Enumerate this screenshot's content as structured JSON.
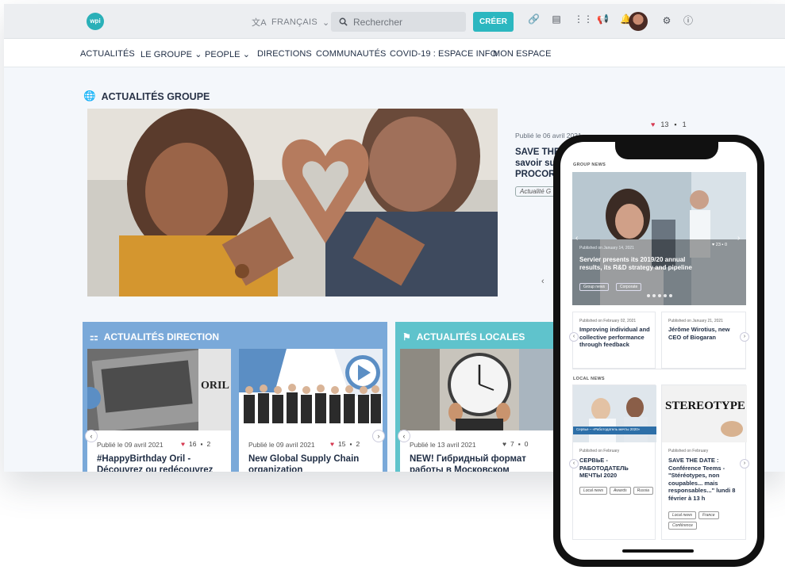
{
  "topbar": {
    "logo": "wpi",
    "language": "FRANÇAIS",
    "search_placeholder": "Rechercher",
    "create_label": "CRÉER"
  },
  "nav": {
    "items": [
      {
        "label": "ACTUALITÉS",
        "chev": ""
      },
      {
        "label": "LE GROUPE",
        "chev": "⌄"
      },
      {
        "label": "PEOPLE",
        "chev": "⌄"
      },
      {
        "label": "DIRECTIONS",
        "chev": ""
      },
      {
        "label": "COMMUNAUTÉS",
        "chev": ""
      },
      {
        "label": "COVID-19 : ESPACE INFO",
        "chev": ""
      },
      {
        "label": "MON ESPACE",
        "chev": ""
      }
    ]
  },
  "group_news": {
    "title": "ACTUALITÉS GROUPE",
    "published": "Publié le 06 avril 2021",
    "headline": "SAVE THE savoir su PROCOR",
    "tag": "Actualité G",
    "likes": "13",
    "comments": "1"
  },
  "direction": {
    "title": "ACTUALITÉS DIRECTION",
    "cards": [
      {
        "published": "Publié le 09 avril 2021",
        "likes": "16",
        "comments": "2",
        "title": "#HappyBirthday Oril - Découvrez ou redécouvrez",
        "image_text": "ORIL"
      },
      {
        "published": "Publié le 09 avril 2021",
        "likes": "15",
        "comments": "2",
        "title": "New Global Supply Chain organization"
      }
    ]
  },
  "local": {
    "title": "ACTUALITÉS LOCALES",
    "cards": [
      {
        "published": "Publié le 13 avril 2021",
        "likes": "7",
        "comments": "0",
        "title": "NEW! Гибридный формат работы в Московском"
      }
    ]
  },
  "phone": {
    "group_label": "GROUP NEWS",
    "hero": {
      "published": "Published on January 14, 2021",
      "title": "Servier presents its 2019/20 annual results, its R&D strategy and pipeline",
      "likes": "23",
      "comments": "0",
      "chips": [
        "Group news",
        "Corporate"
      ]
    },
    "cards": [
      {
        "published": "Published on February 02, 2021",
        "title": "Improving individual and collective performance through feedback"
      },
      {
        "published": "Published on January 21, 2021",
        "title": "Jérôme Wirotius, new CEO of Biogaran"
      }
    ],
    "local_label": "LOCAL NEWS",
    "local_cards": [
      {
        "published": "Published on February",
        "banner": "Сервье – «Работодатель мечты 2020»",
        "title": "СЕРВЬЕ - РАБОТОДАТЕЛЬ МЕЧТЫ 2020",
        "tags": [
          "Local news",
          "Awards",
          "Russia"
        ]
      },
      {
        "published": "Published on February",
        "banner": "STEREOTYPE",
        "title": "SAVE THE DATE : Conférence Teems - \"Stéréotypes, non coupables... mais responsables...\" lundi 8 février à 13 h",
        "tags": [
          "Local news",
          "France",
          "Conférence"
        ]
      }
    ]
  },
  "colors": {
    "accent": "#2cb7c0",
    "direction_panel": "#7aa9d9",
    "local_panel": "#5fc3cc",
    "heart": "#d63b53"
  }
}
